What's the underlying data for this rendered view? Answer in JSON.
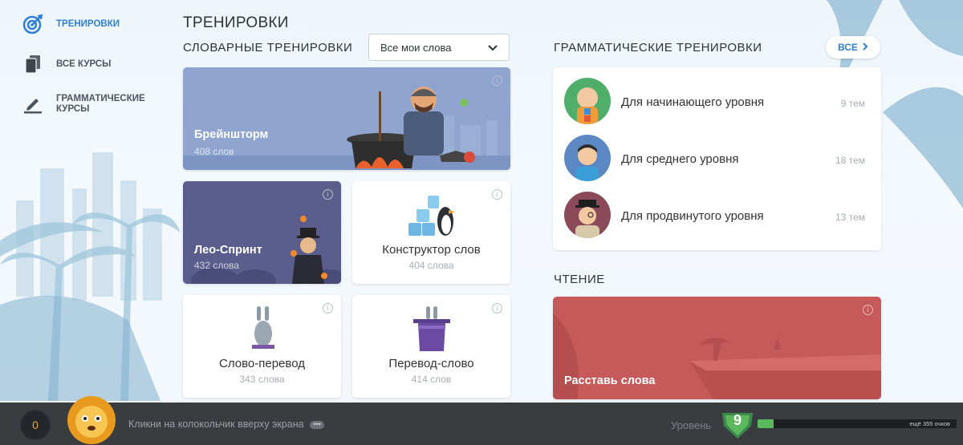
{
  "sidebar": {
    "items": [
      {
        "label": "Тренировки",
        "icon": "target-icon",
        "active": true
      },
      {
        "label": "Все курсы",
        "icon": "courses-icon",
        "active": false
      },
      {
        "label": "Грамматические курсы",
        "icon": "pencil-icon",
        "active": false
      }
    ]
  },
  "page_title": "ТРЕНИРОВКИ",
  "vocab": {
    "heading": "СЛОВАРНЫЕ ТРЕНИРОВКИ",
    "filter": {
      "selected": "Все мои слова"
    },
    "cards": [
      {
        "title": "Брейншторм",
        "count": "408 слов"
      },
      {
        "title": "Лео-Спринт",
        "count": "432 слова"
      },
      {
        "title": "Конструктор слов",
        "count": "404 слова"
      },
      {
        "title": "Слово-перевод",
        "count": "343 слова"
      },
      {
        "title": "Перевод-слово",
        "count": "414 слов"
      }
    ]
  },
  "grammar": {
    "heading": "ГРАММАТИЧЕСКИЕ ТРЕНИРОВКИ",
    "all_label": "ВСЕ",
    "rows": [
      {
        "label": "Для начинающего уровня",
        "count": "9 тем"
      },
      {
        "label": "Для среднего уровня",
        "count": "18 тем"
      },
      {
        "label": "Для продвинутого уровня",
        "count": "13 тем"
      }
    ]
  },
  "reading": {
    "heading": "ЧТЕНИЕ",
    "card": {
      "title": "Расставь слова"
    }
  },
  "footer": {
    "coins": "0",
    "hint": "Кликни на колокольчик вверху экрана",
    "level_label": "Уровень",
    "level": "9",
    "progress_text": "ещё 355 очков",
    "progress": 0.08
  },
  "colors": {
    "accent": "#2f7fd2",
    "brainstorm": "#8fa5d0",
    "sprint": "#5b5d8c",
    "reading": "#c65a5a",
    "footer": "#3a3d40",
    "level": "#5cb85c"
  }
}
